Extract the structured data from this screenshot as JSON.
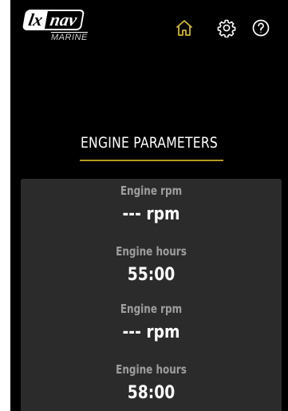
{
  "header": {
    "logo_main_left": "lx",
    "logo_main_right": "nav",
    "logo_sub": "MARINE",
    "icons": {
      "home": "home-icon",
      "settings": "gear-icon",
      "help": "help-icon"
    }
  },
  "colors": {
    "accent": "#b59a1f",
    "background": "#000000",
    "panel": "#2b2b2b",
    "label": "#9e9e9e",
    "value": "#ffffff"
  },
  "main": {
    "title": "ENGINE PARAMETERS",
    "params": [
      {
        "label": "Engine rpm",
        "value": "--- rpm"
      },
      {
        "label": "Engine hours",
        "value": "55:00"
      },
      {
        "label": "Engine rpm",
        "value": "--- rpm"
      },
      {
        "label": "Engine hours",
        "value": "58:00"
      }
    ]
  }
}
